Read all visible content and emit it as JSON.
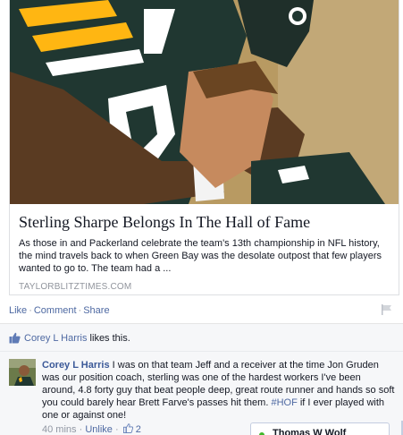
{
  "link_card": {
    "image_alt": "Green Bay Packers players embracing",
    "title": "Sterling Sharpe Belongs In The Hall of Fame",
    "description": "As those in and Packerland celebrate the team's 13th championship in NFL history, the mind travels back to when Green Bay was the desolate outpost that few players wanted to go to. The team had a ...",
    "domain": "TAYLORBLITZTIMES.COM"
  },
  "actions": {
    "like": "Like",
    "comment": "Comment",
    "share": "Share",
    "separator": "·"
  },
  "likes": {
    "name": "Corey L Harris",
    "suffix": " likes this."
  },
  "comment": {
    "author": "Corey L Harris",
    "text_before": " I was on that team Jeff and a receiver at the time Jon Gruden was our position coach, sterling was one of the hardest workers I've been around, 4.8 forty guy that beat people deep, great route runner and hands so soft you could barely hear Brett Farve's passes hit them. ",
    "hashtag": "#HOF",
    "text_after": " if I ever played with one or against one!",
    "time": "40 mins",
    "unlike": "Unlike",
    "separator": "·",
    "like_count": "2"
  },
  "chat": {
    "name": "Thomas W Wolf",
    "status": "online"
  },
  "colors": {
    "link_blue": "#4e69a2",
    "author_blue": "#3b5998",
    "meta_gray": "#9197a3",
    "online_green": "#42b72a",
    "packers_green": "#203731",
    "packers_gold": "#ffb612"
  },
  "icons": {
    "flag": "flag-icon",
    "like": "thumbs-up-icon",
    "mini_like": "thumbs-up-icon",
    "avatar": "avatar-image"
  }
}
